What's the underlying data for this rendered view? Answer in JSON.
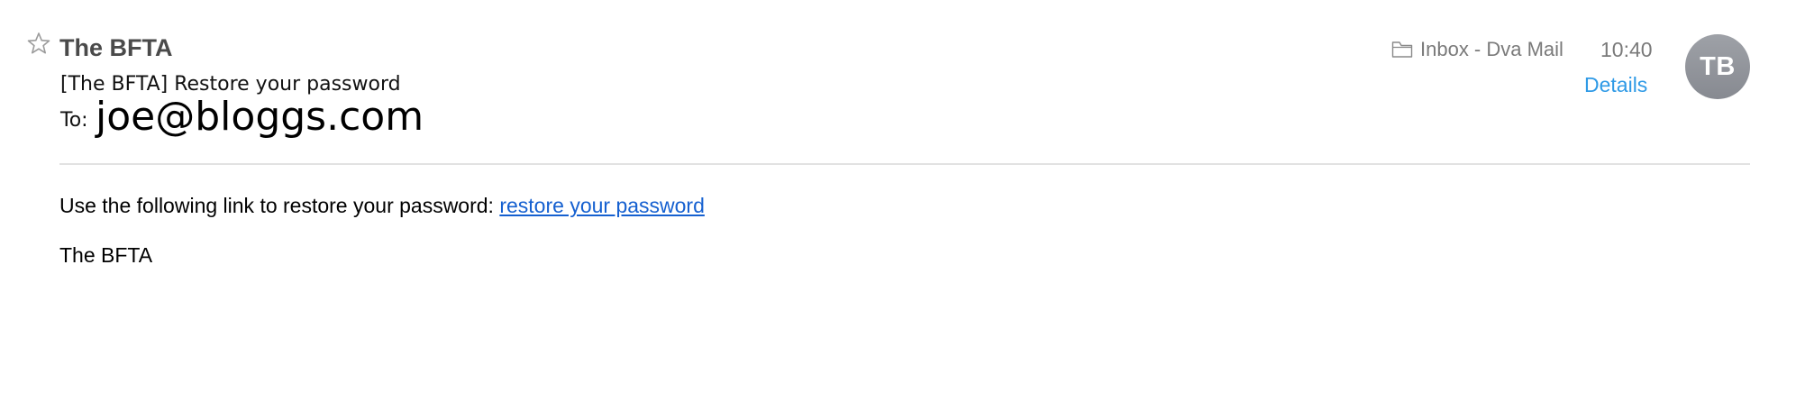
{
  "header": {
    "star_icon": "star-outline-icon",
    "sender_name": "The BFTA",
    "subject": "[The BFTA] Restore your password",
    "to_label": "To:",
    "to_address": "joe@bloggs.com",
    "folder_icon": "folder-icon",
    "mailbox": "Inbox - Dva Mail",
    "time": "10:40",
    "details_label": "Details",
    "avatar_initials": "TB"
  },
  "message": {
    "body_text": "Use the following link to restore your password: ",
    "link_text": "restore your password",
    "signature": "The BFTA"
  },
  "colors": {
    "sender": "#4a4a4a",
    "meta_gray": "#7a7a7a",
    "details_link": "#2f9ae6",
    "body_link": "#1560d0",
    "avatar": "#8e9198",
    "divider": "#e2e2e2"
  }
}
